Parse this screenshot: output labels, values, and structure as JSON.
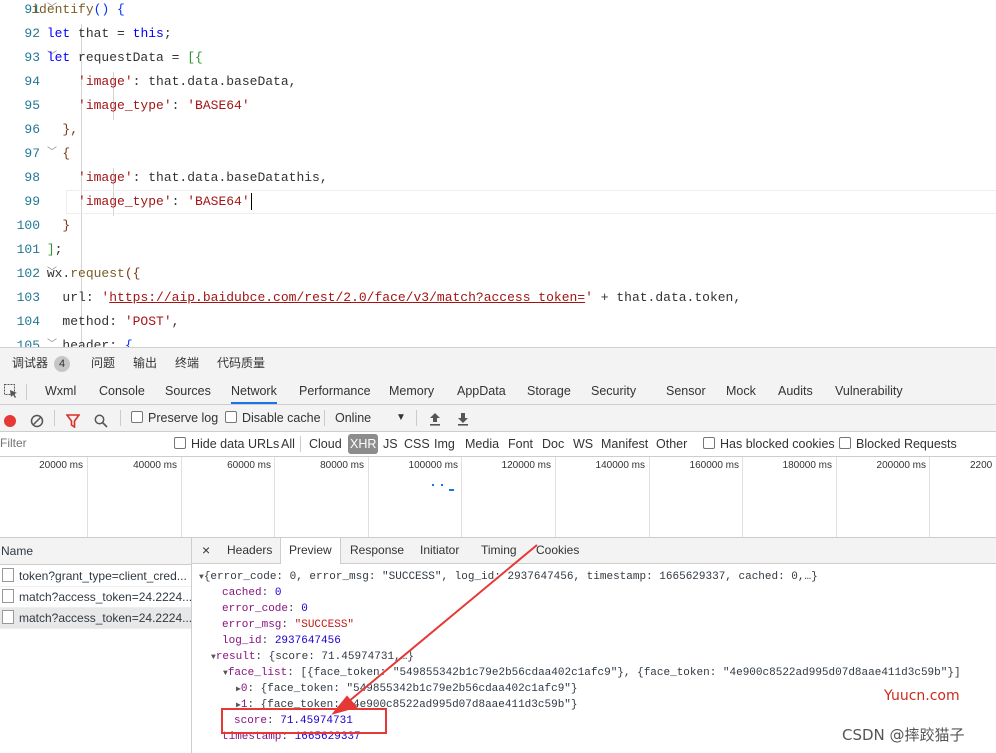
{
  "editor": {
    "lines": [
      {
        "num": "91",
        "fold": "﹀",
        "segments": [
          [
            "",
            "    "
          ],
          [
            "fn",
            "identify"
          ],
          [
            "br1",
            "()"
          ],
          [
            "",
            ""
          ],
          [
            "br1",
            " {"
          ]
        ]
      },
      {
        "num": "92",
        "fold": "",
        "segments": [
          [
            "",
            "      "
          ],
          [
            "kw",
            "let"
          ],
          [
            "",
            " that = "
          ],
          [
            "kw",
            "this"
          ],
          [
            "",
            ";"
          ]
        ]
      },
      {
        "num": "93",
        "fold": "﹀",
        "segments": [
          [
            "",
            "      "
          ],
          [
            "kw",
            "let"
          ],
          [
            "",
            " requestData = "
          ],
          [
            "br2",
            "[{"
          ]
        ]
      },
      {
        "num": "94",
        "fold": "",
        "segments": [
          [
            "",
            "          "
          ],
          [
            "str",
            "'image'"
          ],
          [
            "",
            ": that.data.baseData,"
          ]
        ]
      },
      {
        "num": "95",
        "fold": "",
        "segments": [
          [
            "",
            "          "
          ],
          [
            "str",
            "'image_type'"
          ],
          [
            "",
            ": "
          ],
          [
            "str",
            "'BASE64'"
          ]
        ]
      },
      {
        "num": "96",
        "fold": "",
        "segments": [
          [
            "",
            "        "
          ],
          [
            "br3",
            "},"
          ]
        ]
      },
      {
        "num": "97",
        "fold": "﹀",
        "segments": [
          [
            "",
            "        "
          ],
          [
            "br3",
            "{"
          ]
        ]
      },
      {
        "num": "98",
        "fold": "",
        "segments": [
          [
            "",
            "          "
          ],
          [
            "str",
            "'image'"
          ],
          [
            "",
            ": that.data.baseDatathis,"
          ]
        ]
      },
      {
        "num": "99",
        "fold": "",
        "segments": [
          [
            "",
            "          "
          ],
          [
            "str",
            "'image_type'"
          ],
          [
            "",
            ": "
          ],
          [
            "str",
            "'BASE64'"
          ]
        ]
      },
      {
        "num": "100",
        "fold": "",
        "segments": [
          [
            "",
            "        "
          ],
          [
            "br3",
            "}"
          ]
        ]
      },
      {
        "num": "101",
        "fold": "",
        "segments": [
          [
            "",
            "      "
          ],
          [
            "br2",
            "]"
          ],
          [
            "",
            ";"
          ]
        ]
      },
      {
        "num": "102",
        "fold": "﹀",
        "segments": [
          [
            "",
            "      "
          ],
          [
            "",
            "wx."
          ],
          [
            "fn",
            "request"
          ],
          [
            "br3",
            "({"
          ]
        ]
      },
      {
        "num": "103",
        "fold": "",
        "segments": [
          [
            "",
            "        url: "
          ],
          [
            "str",
            "'"
          ],
          [
            "url",
            "https://aip.baidubce.com/rest/2.0/face/v3/match?access_token="
          ],
          [
            "str",
            "'"
          ],
          [
            "",
            " + that.data.token,"
          ]
        ]
      },
      {
        "num": "104",
        "fold": "",
        "segments": [
          [
            "",
            "        method: "
          ],
          [
            "str",
            "'POST'"
          ],
          [
            "",
            ","
          ]
        ]
      },
      {
        "num": "105",
        "fold": "﹀",
        "segments": [
          [
            "",
            "        header: "
          ],
          [
            "br1",
            "{"
          ]
        ]
      }
    ]
  },
  "drawer_tabs": [
    "调试器",
    "4",
    "问题",
    "输出",
    "终端",
    "代码质量"
  ],
  "panel_tabs": [
    "Wxml",
    "Console",
    "Sources",
    "Network",
    "Performance",
    "Memory",
    "AppData",
    "Storage",
    "Security",
    "Sensor",
    "Mock",
    "Audits",
    "Vulnerability"
  ],
  "active_panel_tab": "Network",
  "toolbar": {
    "preserve_log": "Preserve log",
    "disable_cache": "Disable cache",
    "throttle": "Online",
    "record_color": "#e53935",
    "filter_color": "#d93025"
  },
  "filterbar": {
    "placeholder": "Filter",
    "hide_data_urls": "Hide data URLs",
    "types": [
      "All",
      "Cloud",
      "XHR",
      "JS",
      "CSS",
      "Img",
      "Media",
      "Font",
      "Doc",
      "WS",
      "Manifest",
      "Other"
    ],
    "active_type": "XHR",
    "has_blocked_cookies": "Has blocked cookies",
    "blocked_requests": "Blocked Requests"
  },
  "timeline": {
    "ticks": [
      "20000 ms",
      "40000 ms",
      "60000 ms",
      "80000 ms",
      "100000 ms",
      "120000 ms",
      "140000 ms",
      "160000 ms",
      "180000 ms",
      "200000 ms",
      "2200"
    ]
  },
  "requests": {
    "header": "Name",
    "items": [
      "token?grant_type=client_cred...",
      "match?access_token=24.2224...",
      "match?access_token=24.2224..."
    ]
  },
  "detail": {
    "close": "×",
    "tabs": [
      "Headers",
      "Preview",
      "Response",
      "Initiator",
      "Timing",
      "Cookies"
    ],
    "active_tab": "Preview",
    "json": {
      "root": "{error_code: 0, error_msg: \"SUCCESS\", log_id: 2937647456, timestamp: 1665629337, cached: 0,…}",
      "cached_k": "cached",
      "cached_v": "0",
      "error_code_k": "error_code",
      "error_code_v": "0",
      "error_msg_k": "error_msg",
      "error_msg_v": "\"SUCCESS\"",
      "log_id_k": "log_id",
      "log_id_v": "2937647456",
      "result_k": "result",
      "result_v": "{score: 71.45974731,…}",
      "face_list_k": "face_list",
      "face_list_v": "[{face_token: \"549855342b1c79e2b56cdaa402c1afc9\"}, {face_token: \"4e900c8522ad995d07d8aae411d3c59b\"}]",
      "item0_k": "0",
      "item0_v": "{face_token: \"549855342b1c79e2b56cdaa402c1afc9\"}",
      "item1_k": "1",
      "item1_v": "{face_token: \"4e900c8522ad995d07d8aae411d3c59b\"}",
      "score_k": "score",
      "score_v": "71.45974731",
      "timestamp_k": "timestamp",
      "timestamp_v": "1665629337"
    }
  },
  "watermarks": {
    "site": "Yuucn.com",
    "author": "CSDN @摔跤猫子"
  },
  "colors": {
    "highlight": "#e53935",
    "accent": "#1a73e8"
  }
}
